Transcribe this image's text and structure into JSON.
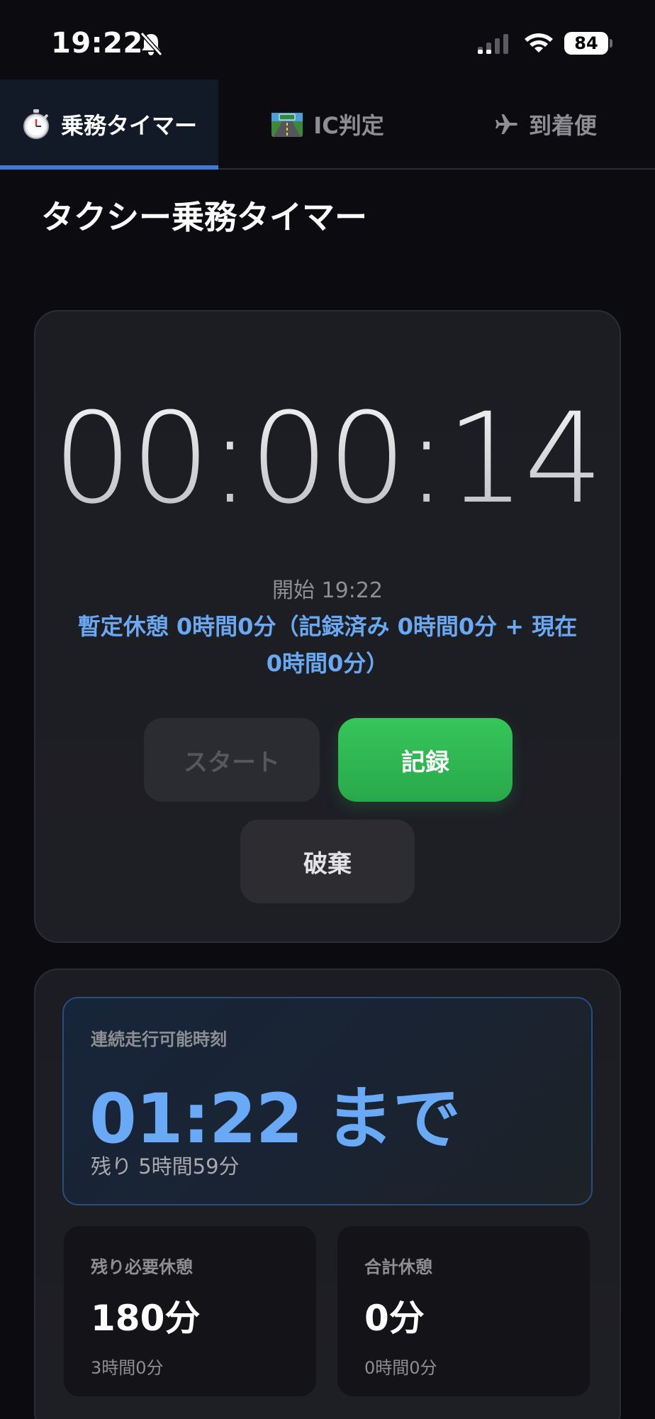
{
  "status_bar": {
    "time": "19:22",
    "battery": "84",
    "icons": [
      "bell-slash-icon",
      "cellular-signal-icon",
      "wifi-icon",
      "battery-icon"
    ]
  },
  "tabs": [
    {
      "label": "乗務タイマー",
      "icon": "stopwatch-icon",
      "active": true
    },
    {
      "label": "IC判定",
      "icon": "highway-icon",
      "active": false
    },
    {
      "label": "到着便",
      "icon": "airplane-icon",
      "active": false
    }
  ],
  "page": {
    "title": "タクシー乗務タイマー"
  },
  "timer": {
    "display": "00:00:14",
    "start_time": "開始 19:22",
    "break_info": "暫定休憩 0時間0分（記録済み 0時間0分 + 現在 0時間0分）",
    "buttons": {
      "start": "スタート",
      "record": "記録",
      "discard": "破棄"
    }
  },
  "summary": {
    "drive_label": "連続走行可能時刻",
    "drive_value": "01:22 まで",
    "drive_remaining": "残り 5時間59分",
    "required_break": {
      "label": "残り必要休憩",
      "value": "180分",
      "sub": "3時間0分"
    },
    "total_break": {
      "label": "合計休憩",
      "value": "0分",
      "sub": "0時間0分"
    }
  },
  "colors": {
    "background": "#0b0b10",
    "accent_blue": "#6aa9f5",
    "tab_indicator": "#3b7bd8",
    "record_green": "#34c759"
  }
}
